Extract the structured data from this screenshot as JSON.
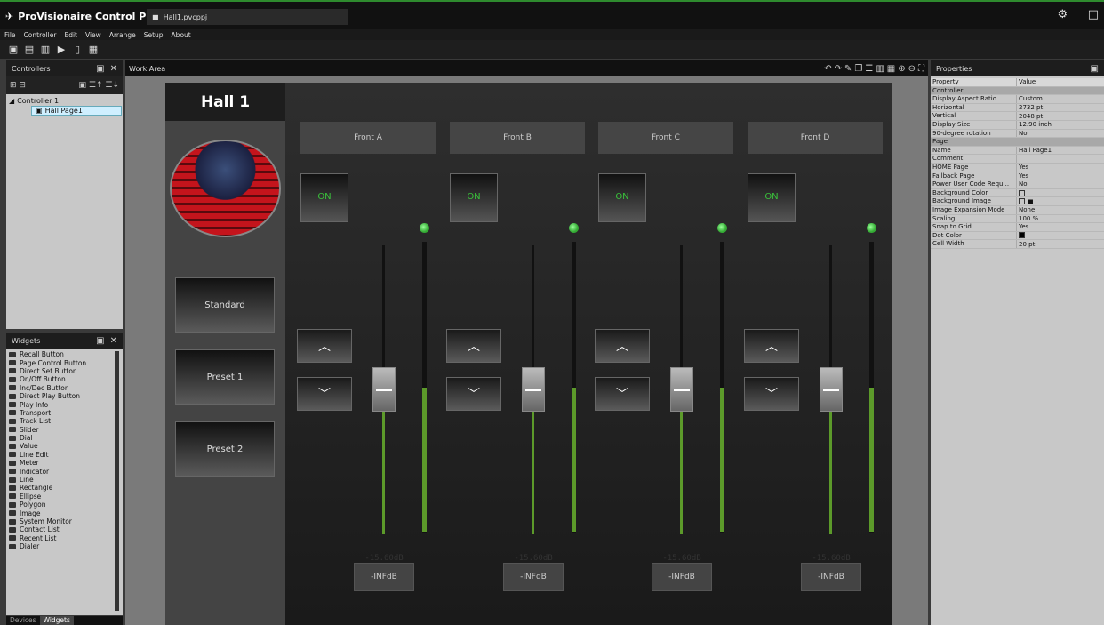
{
  "app": {
    "brand": "ProVisionaire Control PLUS",
    "file_tab": "Hall1.pvcppj"
  },
  "menu": [
    "File",
    "Controller",
    "Edit",
    "View",
    "Arrange",
    "Setup",
    "About"
  ],
  "controllers_panel": {
    "title": "Controllers",
    "tree": {
      "root": "Controller 1",
      "page": "Hall Page1"
    }
  },
  "widgets_panel": {
    "title": "Widgets",
    "items": [
      "Recall Button",
      "Page Control Button",
      "Direct Set Button",
      "On/Off Button",
      "Inc/Dec Button",
      "Direct Play Button",
      "Play Info",
      "Transport",
      "Track List",
      "Slider",
      "Dial",
      "Value",
      "Line Edit",
      "Meter",
      "Indicator",
      "Line",
      "Rectangle",
      "Ellipse",
      "Polygon",
      "Image",
      "System Monitor",
      "Contact List",
      "Recent List",
      "Dialer"
    ]
  },
  "bottom_tabs": [
    "Devices",
    "Widgets"
  ],
  "work_area": {
    "title": "Work Area"
  },
  "page": {
    "title": "Hall 1",
    "presets": [
      "Standard",
      "Preset 1",
      "Preset 2"
    ],
    "channels": [
      {
        "label": "Front A",
        "on": "ON",
        "db": "-15.60dB",
        "value": "-INFdB"
      },
      {
        "label": "Front B",
        "on": "ON",
        "db": "-15.60dB",
        "value": "-INFdB"
      },
      {
        "label": "Front C",
        "on": "ON",
        "db": "-15.60dB",
        "value": "-INFdB"
      },
      {
        "label": "Front D",
        "on": "ON",
        "db": "-15.60dB",
        "value": "-INFdB"
      }
    ]
  },
  "properties": {
    "title": "Properties",
    "header": [
      "Property",
      "Value"
    ],
    "rows": [
      {
        "section": "Controller"
      },
      {
        "k": "Display Aspect Ratio",
        "v": "Custom"
      },
      {
        "k": "Horizontal",
        "v": "2732 pt"
      },
      {
        "k": "Vertical",
        "v": "2048 pt"
      },
      {
        "k": "Display Size",
        "v": "12.90 inch"
      },
      {
        "k": "90-degree rotation",
        "v": "No"
      },
      {
        "section": "Page"
      },
      {
        "k": "Name",
        "v": "Hall Page1"
      },
      {
        "k": "Comment",
        "v": ""
      },
      {
        "k": "HOME Page",
        "v": "Yes"
      },
      {
        "k": "Fallback Page",
        "v": "Yes"
      },
      {
        "k": "Power User Code Requ...",
        "v": "No"
      },
      {
        "k": "Background Color",
        "v": ""
      },
      {
        "k": "Background Image",
        "v": ""
      },
      {
        "k": "Image Expansion Mode",
        "v": "None"
      },
      {
        "k": "Scaling",
        "v": "100 %"
      },
      {
        "k": "Snap to Grid",
        "v": "Yes"
      },
      {
        "k": "Dot Color",
        "v": ""
      },
      {
        "k": "Cell Width",
        "v": "20 pt"
      }
    ]
  }
}
